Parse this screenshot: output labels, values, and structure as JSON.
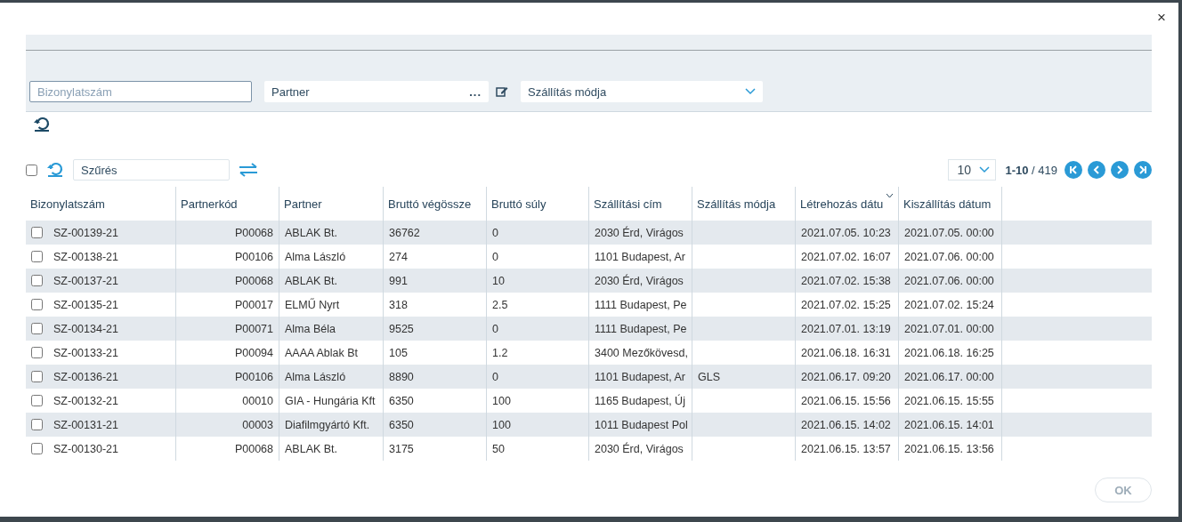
{
  "filters": {
    "document_number": {
      "placeholder": "Bizonylatszám"
    },
    "partner": {
      "placeholder": "Partner",
      "more": "..."
    },
    "shipping_method": {
      "placeholder": "Szállítás módja"
    }
  },
  "toolbar": {
    "select_all": {
      "checked": false
    },
    "search": {
      "placeholder": "Szűrés"
    },
    "page_size": "10",
    "range": "1-10",
    "total": "/ 419"
  },
  "table": {
    "columns": [
      {
        "label": "Bizonylatszám",
        "kind": "text",
        "sorted": false
      },
      {
        "label": "Partnerkód",
        "kind": "code",
        "sorted": false
      },
      {
        "label": "Partner",
        "kind": "text",
        "sorted": false
      },
      {
        "label": "Bruttó végössze",
        "kind": "text",
        "sorted": false
      },
      {
        "label": "Bruttó súly",
        "kind": "text",
        "sorted": false
      },
      {
        "label": "Szállítási cím",
        "kind": "text",
        "sorted": false
      },
      {
        "label": "Szállítás módja",
        "kind": "text",
        "sorted": false
      },
      {
        "label": "Létrehozás dátu",
        "kind": "text",
        "sorted": true
      },
      {
        "label": "Kiszállítás dátum",
        "kind": "text",
        "sorted": false
      }
    ],
    "rows": [
      {
        "checked": false,
        "cells": [
          "SZ-00139-21",
          "P00068",
          "ABLAK Bt.",
          "36762",
          "0",
          "2030 Érd, Virágos",
          "",
          "2021.07.05. 10:23",
          "2021.07.05. 00:00"
        ]
      },
      {
        "checked": false,
        "cells": [
          "SZ-00138-21",
          "P00106",
          "Alma László",
          "274",
          "0",
          "1101 Budapest, Ar",
          "",
          "2021.07.02. 16:07",
          "2021.07.06. 00:00"
        ]
      },
      {
        "checked": false,
        "cells": [
          "SZ-00137-21",
          "P00068",
          "ABLAK Bt.",
          "991",
          "10",
          "2030 Érd, Virágos",
          "",
          "2021.07.02. 15:38",
          "2021.07.06. 00:00"
        ]
      },
      {
        "checked": false,
        "cells": [
          "SZ-00135-21",
          "P00017",
          "ELMŰ Nyrt",
          "318",
          "2.5",
          "1111 Budapest, Pe",
          "",
          "2021.07.02. 15:25",
          "2021.07.02. 15:24"
        ]
      },
      {
        "checked": false,
        "cells": [
          "SZ-00134-21",
          "P00071",
          "Alma Béla",
          "9525",
          "0",
          "1111 Budapest, Pe",
          "",
          "2021.07.01. 13:19",
          "2021.07.01. 00:00"
        ]
      },
      {
        "checked": false,
        "cells": [
          "SZ-00133-21",
          "P00094",
          "AAAA Ablak Bt",
          "105",
          "1.2",
          "3400 Mezőkövesd,",
          "",
          "2021.06.18. 16:31",
          "2021.06.18. 16:25"
        ]
      },
      {
        "checked": false,
        "cells": [
          "SZ-00136-21",
          "P00106",
          "Alma László",
          "8890",
          "0",
          "1101 Budapest, Ar",
          "GLS",
          "2021.06.17. 09:20",
          "2021.06.17. 00:00"
        ]
      },
      {
        "checked": false,
        "cells": [
          "SZ-00132-21",
          "00010",
          "GIA - Hungária Kft",
          "6350",
          "100",
          "1165 Budapest, Új",
          "",
          "2021.06.15. 15:56",
          "2021.06.15. 15:55"
        ]
      },
      {
        "checked": false,
        "cells": [
          "SZ-00131-21",
          "00003",
          "Diafilmgyártó Kft.",
          "6350",
          "100",
          "1011 Budapest Pol",
          "",
          "2021.06.15. 14:02",
          "2021.06.15. 14:01"
        ]
      },
      {
        "checked": false,
        "cells": [
          "SZ-00130-21",
          "P00068",
          "ABLAK Bt.",
          "3175",
          "50",
          "2030 Érd, Virágos",
          "",
          "2021.06.15. 13:57",
          "2021.06.15. 13:56"
        ]
      }
    ]
  },
  "footer": {
    "ok": {
      "label": "OK",
      "disabled": true
    }
  },
  "close": "×"
}
